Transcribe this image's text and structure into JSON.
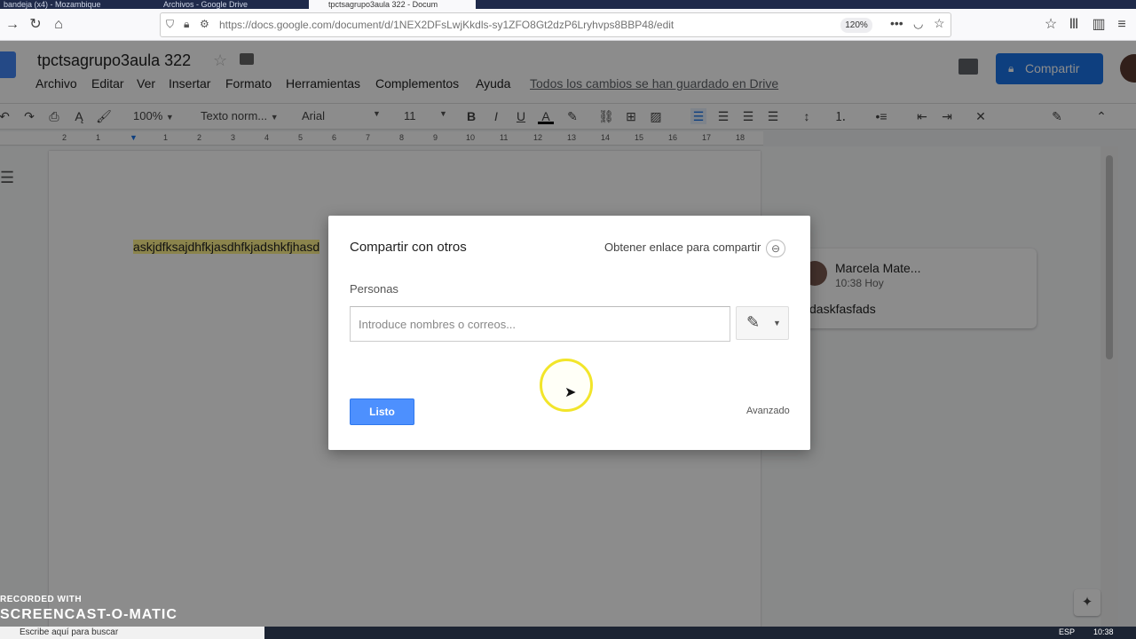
{
  "browser": {
    "tabs": [
      {
        "label": "bandeja (x4) - Mozambique",
        "active": false
      },
      {
        "label": "Archivos - Google Drive",
        "active": false
      },
      {
        "label": "tpctsagrupo3aula 322 - Docum",
        "active": true
      }
    ],
    "url": "https://docs.google.com/document/d/1NEX2DFsLwjKkdls-sy1ZFO8Gt2dzP6Lryhvps8BBP48/edit",
    "zoom": "120%"
  },
  "docs": {
    "title": "tpctsagrupo3aula 322",
    "menu": [
      "Archivo",
      "Editar",
      "Ver",
      "Insertar",
      "Formato",
      "Herramientas",
      "Complementos",
      "Ayuda"
    ],
    "saved_status": "Todos los cambios se han guardado en Drive",
    "share_label": "Compartir",
    "toolbar": {
      "zoom": "100%",
      "style": "Texto norm...",
      "font": "Arial",
      "size": "11"
    },
    "ruler_numbers": [
      "2",
      "1",
      "1",
      "2",
      "3",
      "4",
      "5",
      "6",
      "7",
      "8",
      "9",
      "10",
      "11",
      "12",
      "13",
      "14",
      "15",
      "16",
      "17",
      "18"
    ],
    "body_text": "askjdfksajdhfkjasdhfkjadshkfjhasd",
    "comment": {
      "author": "Marcela Mate...",
      "time": "10:38 Hoy",
      "body": "daskfasfads"
    }
  },
  "dialog": {
    "title": "Compartir con otros",
    "get_link": "Obtener enlace para compartir",
    "people_label": "Personas",
    "people_placeholder": "Introduce nombres o correos...",
    "done_label": "Listo",
    "advanced_label": "Avanzado"
  },
  "watermark": {
    "line1": "RECORDED WITH",
    "line2": "SCREENCAST-O-MATIC"
  },
  "taskbar": {
    "search_placeholder": "Escribe aquí para buscar",
    "lang": "ESP",
    "time": "10:38"
  }
}
